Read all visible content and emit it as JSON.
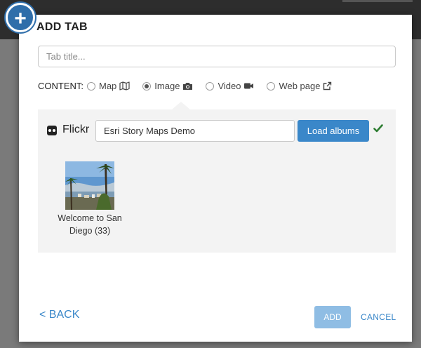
{
  "dialog": {
    "title": "ADD TAB",
    "tab_title_placeholder": "Tab title...",
    "tab_title_value": ""
  },
  "content": {
    "label": "CONTENT:",
    "options": [
      {
        "label": "Map",
        "icon": "map-icon",
        "selected": false
      },
      {
        "label": "Image",
        "icon": "camera-icon",
        "selected": true
      },
      {
        "label": "Video",
        "icon": "video-camera-icon",
        "selected": false
      },
      {
        "label": "Web page",
        "icon": "external-link-icon",
        "selected": false
      }
    ]
  },
  "flickr": {
    "service_label": "Flickr",
    "user_value": "Esri Story Maps Demo",
    "load_button": "Load albums",
    "status_icon": "check-icon",
    "status_color": "#2e7d32",
    "albums": [
      {
        "title": "Welcome to San Diego (33)"
      }
    ]
  },
  "footer": {
    "back_label": "< BACK",
    "add_label": "ADD",
    "cancel_label": "CANCEL"
  },
  "colors": {
    "accent": "#3a87c9",
    "accent_disabled": "#8fbde4",
    "badge": "#2f6eaa"
  }
}
